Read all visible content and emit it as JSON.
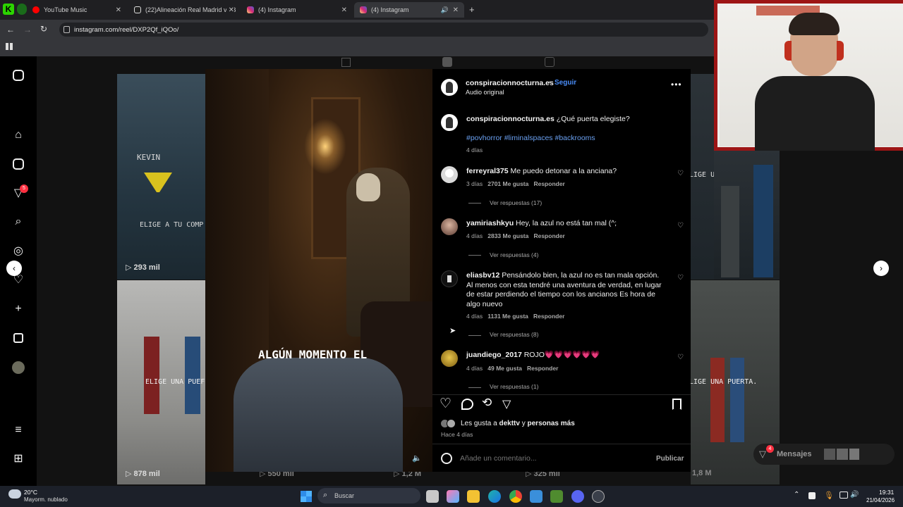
{
  "browser": {
    "tabs": [
      {
        "title": "YouTube Music",
        "icon": "youtube-music-icon",
        "color": "#ff0000"
      },
      {
        "title": "(22)Alineación Real Madrid vs B",
        "icon": "tiktok-icon",
        "color": "#111111"
      },
      {
        "title": "(4) Instagram",
        "icon": "instagram-icon",
        "color": "#d62976"
      },
      {
        "title": "(4) Instagram",
        "icon": "instagram-icon",
        "color": "#d62976"
      }
    ],
    "url": "instagram.com/reel/DXP2Qf_iQOo/"
  },
  "thumbnails": [
    {
      "caption": "KEVIN",
      "caption2": "ELIGE A TU COMP",
      "views": "293 mil"
    },
    {
      "caption": "ELIGE UNA PUEF",
      "views": "878 mil"
    },
    {
      "caption": "LIGE UNA PUERTA.",
      "views": ""
    },
    {
      "caption": "LIGE UNA PUERTA.",
      "views": "1,8 M"
    }
  ],
  "bottom_views": [
    "550 mil",
    "1,2 M",
    "325 mil"
  ],
  "reel": {
    "overlay_text": "ALGÚN MOMENTO EL"
  },
  "post": {
    "author": "conspiracionnocturna.es",
    "follow": "Seguir",
    "audio": "Audio original",
    "caption": "¿Qué puerta elegiste?",
    "hashtags": "#povhorror #liminalspaces #backrooms",
    "caption_age": "4 días",
    "comments": [
      {
        "user": "ferreyral375",
        "text": "Me puedo detonar a la anciana?",
        "age": "3 días",
        "likes": "2701 Me gusta",
        "reply": "Responder",
        "replies": "Ver respuestas (17)"
      },
      {
        "user": "yamiriashkyu",
        "text": "Hey, la azul no está tan mal (^;",
        "age": "4 días",
        "likes": "2833 Me gusta",
        "reply": "Responder",
        "replies": "Ver respuestas (4)"
      },
      {
        "user": "eliasbv12",
        "text": "Pensándolo bien, la azul no es tan mala opción. Al menos con esta tendré una aventura de verdad, en lugar de estar perdiendo el tiempo con los ancianos Es hora de algo nuevo",
        "age": "4 días",
        "likes": "1131 Me gusta",
        "reply": "Responder",
        "replies": "Ver respuestas (8)"
      },
      {
        "user": "juandiego_2017",
        "text": "ROJO💗💗💗💗💗💗",
        "age": "4 días",
        "likes": "49 Me gusta",
        "reply": "Responder",
        "replies": "Ver respuestas (1)"
      }
    ],
    "liked_by_prefix": "Les gusta a",
    "liked_by_user": "dekttv",
    "liked_by_and": "y",
    "liked_by_others": "personas más",
    "post_age": "Hace 4 días",
    "comment_placeholder": "Añade un comentario...",
    "publish": "Publicar"
  },
  "right_panel": {
    "messages": "Mensajes",
    "messages_badge": "4"
  },
  "nav_badge": "5",
  "taskbar": {
    "temp": "20°C",
    "weather": "Mayorm. nublado",
    "search": "Buscar",
    "time": "19:31",
    "date": "21/04/2026"
  }
}
